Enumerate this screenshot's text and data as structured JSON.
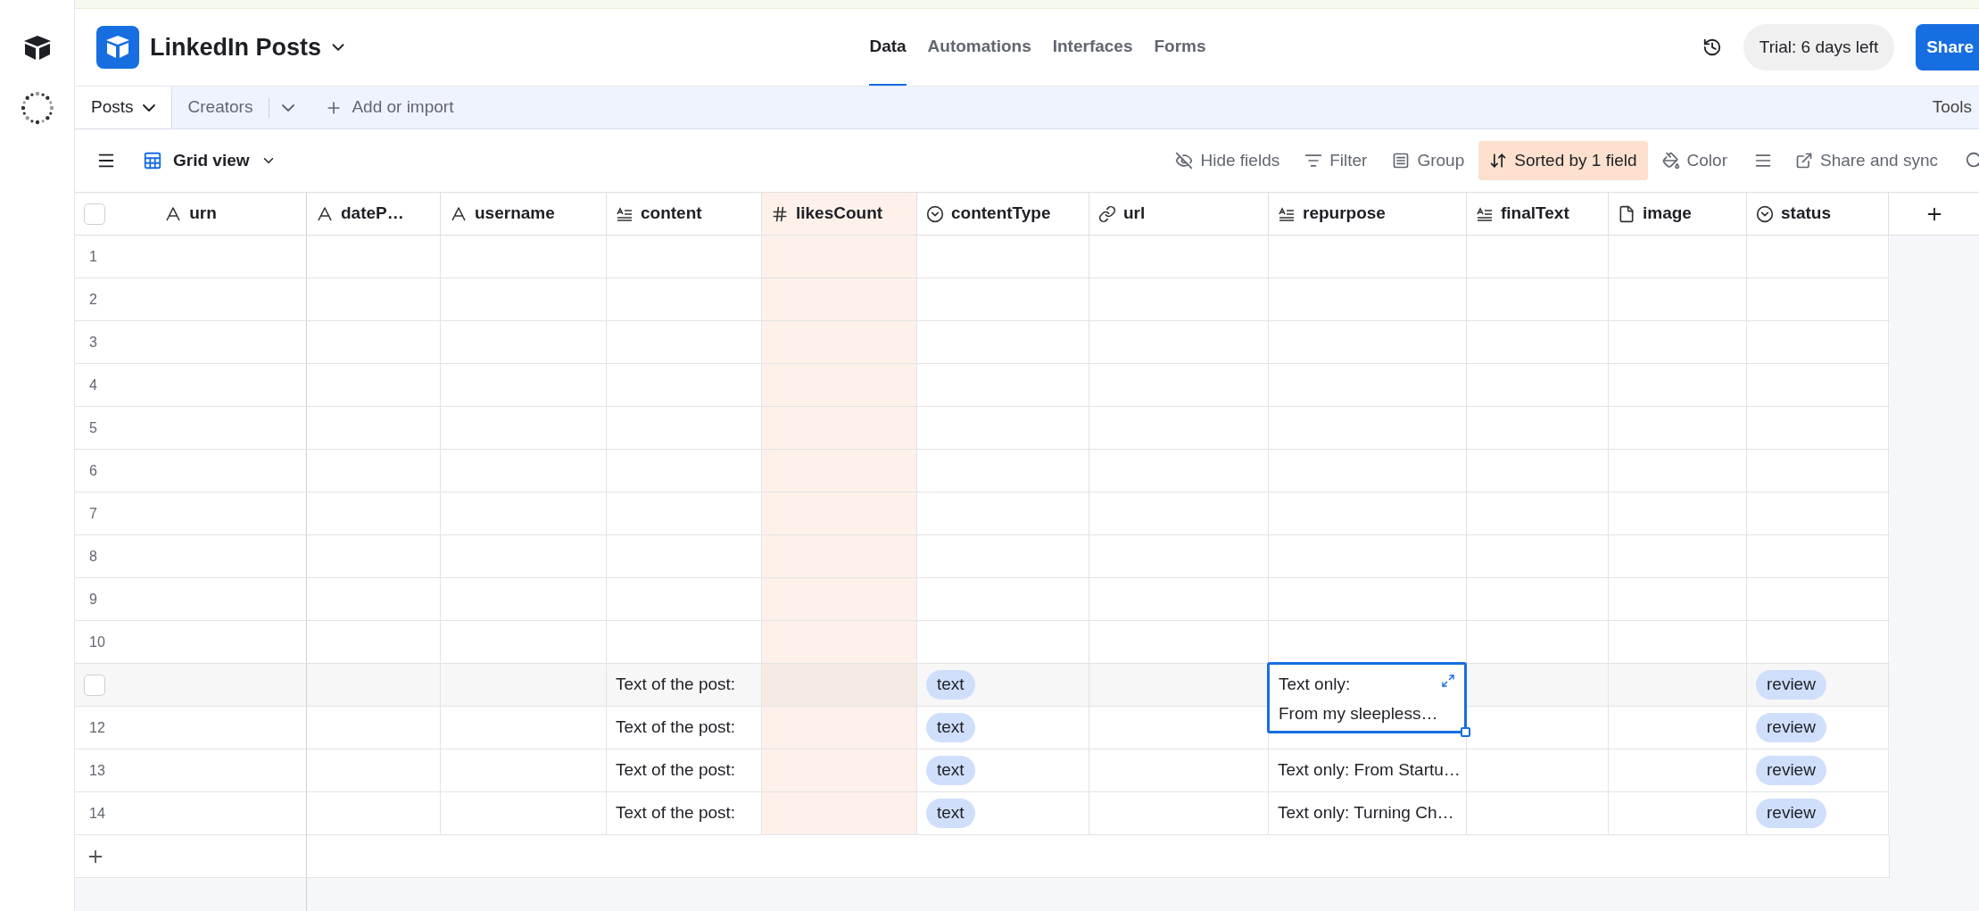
{
  "base": {
    "title": "LinkedIn Posts"
  },
  "nav": [
    {
      "label": "Data",
      "selected": true
    },
    {
      "label": "Automations",
      "selected": false
    },
    {
      "label": "Interfaces",
      "selected": false
    },
    {
      "label": "Forms",
      "selected": false
    }
  ],
  "trial": "Trial: 6 days left",
  "share_button": "Share",
  "table_tabs": [
    {
      "label": "Posts",
      "selected": true
    },
    {
      "label": "Creators",
      "selected": false
    }
  ],
  "add_import": "Add or import",
  "tools": "Tools",
  "view": {
    "label": "Grid view"
  },
  "toolbar": [
    {
      "label": "Hide fields",
      "kind": "hide",
      "active": false
    },
    {
      "label": "Filter",
      "kind": "filter",
      "active": false
    },
    {
      "label": "Group",
      "kind": "group",
      "active": false
    },
    {
      "label": "Sorted by 1 field",
      "kind": "sort",
      "active": true
    },
    {
      "label": "Color",
      "kind": "color",
      "active": false
    },
    {
      "label": "Share and sync",
      "kind": "share",
      "active": false
    }
  ],
  "columns": [
    {
      "label": "urn",
      "kind": "text",
      "sorted": false
    },
    {
      "label": "dateP…",
      "kind": "text",
      "sorted": false
    },
    {
      "label": "username",
      "kind": "text",
      "sorted": false
    },
    {
      "label": "content",
      "kind": "longtext",
      "sorted": false
    },
    {
      "label": "likesCount",
      "kind": "number",
      "sorted": true
    },
    {
      "label": "contentType",
      "kind": "select",
      "sorted": false
    },
    {
      "label": "url",
      "kind": "link",
      "sorted": false
    },
    {
      "label": "repurpose",
      "kind": "longtext",
      "sorted": false
    },
    {
      "label": "finalText",
      "kind": "longtext",
      "sorted": false
    },
    {
      "label": "image",
      "kind": "file",
      "sorted": false
    },
    {
      "label": "status",
      "kind": "select",
      "sorted": false
    }
  ],
  "rows": [
    {
      "number": "1",
      "hovered": false
    },
    {
      "number": "2",
      "hovered": false
    },
    {
      "number": "3",
      "hovered": false
    },
    {
      "number": "4",
      "hovered": false
    },
    {
      "number": "5",
      "hovered": false
    },
    {
      "number": "6",
      "hovered": false
    },
    {
      "number": "7",
      "hovered": false
    },
    {
      "number": "8",
      "hovered": false
    },
    {
      "number": "9",
      "hovered": false
    },
    {
      "number": "10",
      "hovered": false
    },
    {
      "hovered": true,
      "cells": [
        {
          "kind": "empty"
        },
        {
          "kind": "empty"
        },
        {
          "kind": "text",
          "text": "Text of the post:"
        },
        {
          "kind": "empty"
        },
        {
          "kind": "tag",
          "text": "text"
        },
        {
          "kind": "empty"
        },
        {
          "kind": "expanded",
          "selected": true,
          "lines": [
            "Text only:",
            "From my sleepless…"
          ]
        },
        {
          "kind": "empty"
        },
        {
          "kind": "empty"
        },
        {
          "kind": "tag",
          "text": "review"
        }
      ]
    },
    {
      "number": "12",
      "hovered": false,
      "cells": [
        {
          "kind": "empty"
        },
        {
          "kind": "empty"
        },
        {
          "kind": "text",
          "text": "Text of the post:"
        },
        {
          "kind": "empty"
        },
        {
          "kind": "tag",
          "text": "text"
        },
        {
          "kind": "empty"
        },
        {
          "kind": "empty"
        },
        {
          "kind": "empty"
        },
        {
          "kind": "empty"
        },
        {
          "kind": "tag",
          "text": "review"
        }
      ]
    },
    {
      "number": "13",
      "hovered": false,
      "cells": [
        {
          "kind": "empty"
        },
        {
          "kind": "empty"
        },
        {
          "kind": "text",
          "text": "Text of the post:"
        },
        {
          "kind": "empty"
        },
        {
          "kind": "tag",
          "text": "text"
        },
        {
          "kind": "empty"
        },
        {
          "kind": "text",
          "text": "Text only: From Startu…"
        },
        {
          "kind": "empty"
        },
        {
          "kind": "empty"
        },
        {
          "kind": "tag",
          "text": "review"
        }
      ]
    },
    {
      "number": "14",
      "hovered": false,
      "cells": [
        {
          "kind": "empty"
        },
        {
          "kind": "empty"
        },
        {
          "kind": "text",
          "text": "Text of the post:"
        },
        {
          "kind": "empty"
        },
        {
          "kind": "tag",
          "text": "text"
        },
        {
          "kind": "empty"
        },
        {
          "kind": "text",
          "text": "Text only: Turning Ch…"
        },
        {
          "kind": "empty"
        },
        {
          "kind": "empty"
        },
        {
          "kind": "tag",
          "text": "review"
        }
      ]
    }
  ]
}
